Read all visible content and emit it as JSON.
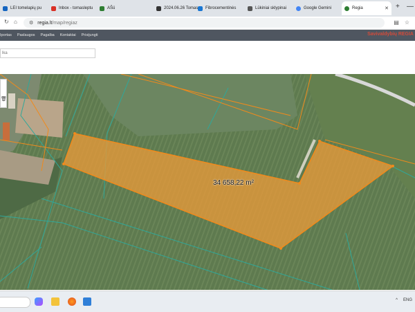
{
  "browser": {
    "tabs": [
      {
        "label": "LEI tomelapių pu",
        "favicon_color": "#1565c0",
        "active": false
      },
      {
        "label": "Inbox - tomasleptu",
        "favicon_color": "#d93025",
        "active": false
      },
      {
        "label": "AŠü",
        "favicon_color": "#2e7d32",
        "active": false
      },
      {
        "label": "2024.06.26 Tomas",
        "favicon_color": "#333333",
        "active": false
      },
      {
        "label": "Fibrocementinės",
        "favicon_color": "#1976d2",
        "active": false
      },
      {
        "label": "Lūkiniai sklypinai",
        "favicon_color": "#555555",
        "active": false
      },
      {
        "label": "Google Gemini",
        "favicon_color": "#4285f4",
        "active": false
      },
      {
        "label": "Regia",
        "favicon_color": "#2e7d32",
        "active": true
      }
    ],
    "new_tab": "+",
    "window_controls": [
      "—",
      "▢",
      "✕"
    ],
    "address": {
      "host": "regia.lt",
      "path": "/map/regiaz"
    }
  },
  "site": {
    "nav_items": [
      "Iportas",
      "Paslaugos",
      "Pagalba",
      "Kontaktai",
      "Prisijungti"
    ],
    "brand": "Savivaldybių REGIA",
    "search_placeholder": "lka"
  },
  "map": {
    "parcel_area_label": "34 658,22 m²",
    "parcel_color": "#e89a3a",
    "boundary_color": "#f08a1c",
    "cadastre_line_color": "#2fa89a"
  },
  "taskbar": {
    "tray_label": "ENG",
    "tray_chevron": "^"
  }
}
